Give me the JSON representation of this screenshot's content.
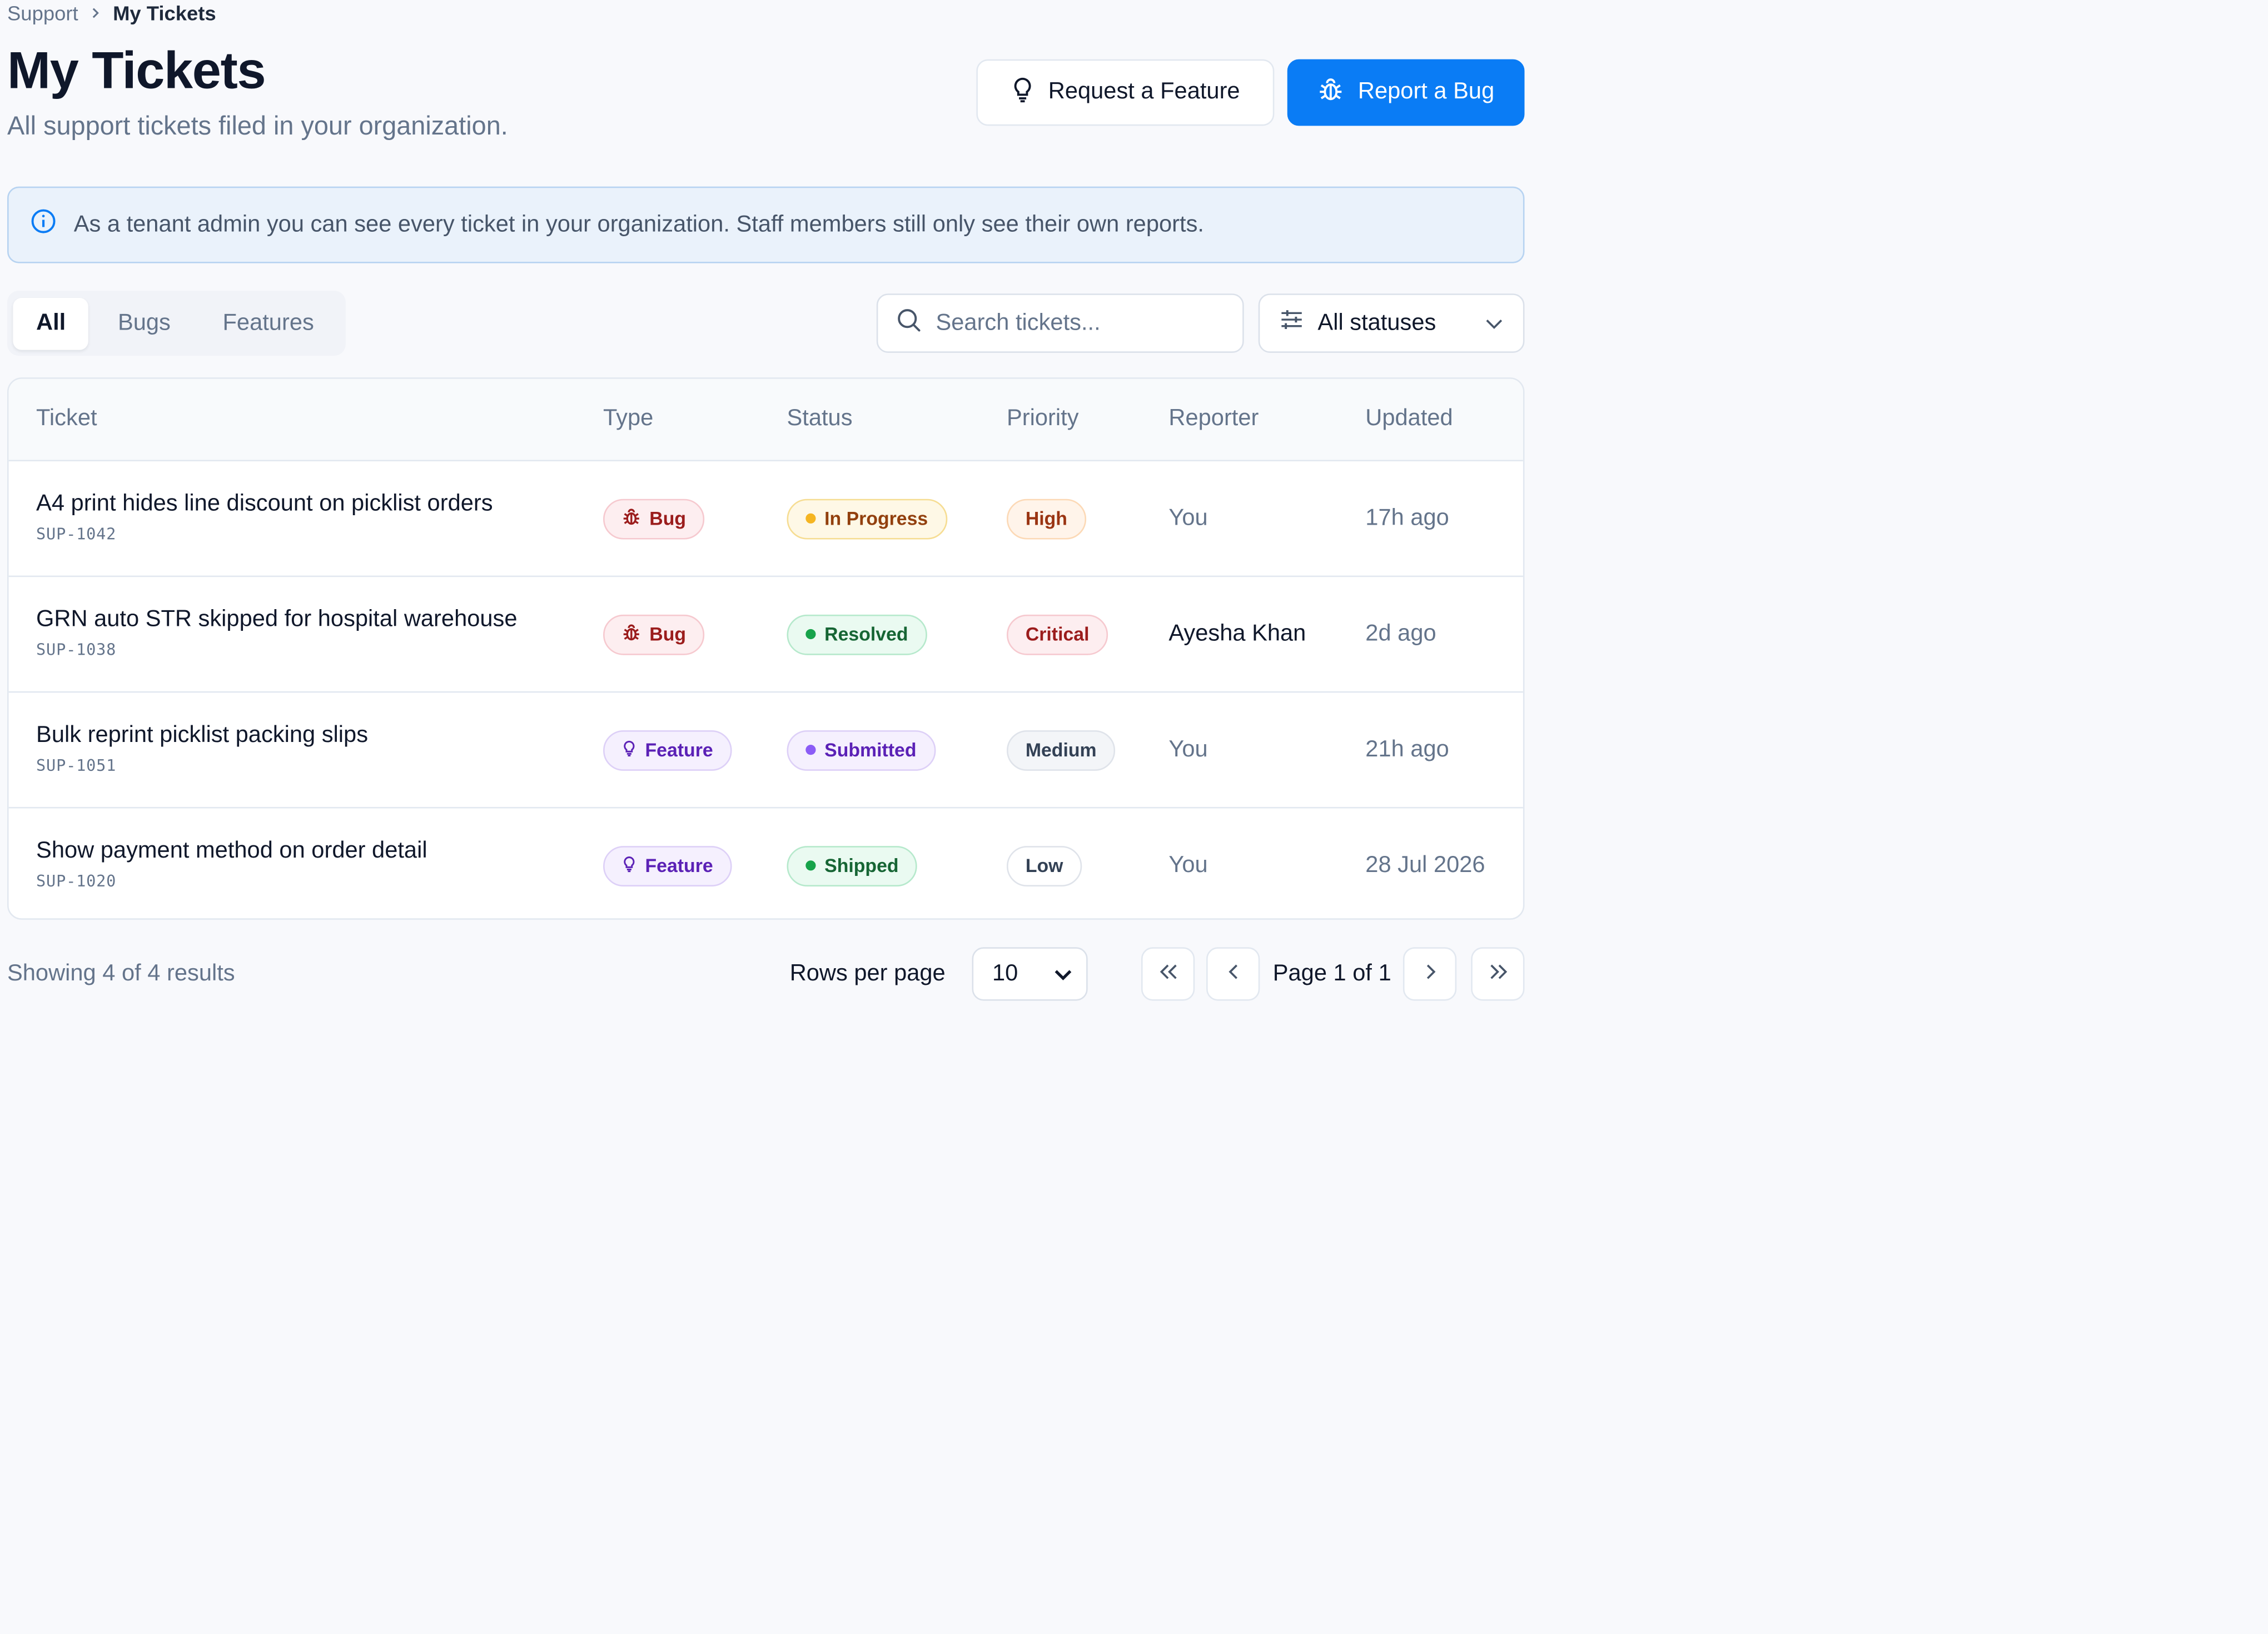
{
  "breadcrumb": {
    "parent": "Support",
    "current": "My Tickets"
  },
  "header": {
    "title": "My Tickets",
    "subtitle": "All support tickets filed in your organization.",
    "request_feature_label": "Request a Feature",
    "report_bug_label": "Report a Bug"
  },
  "banner": {
    "text": "As a tenant admin you can see every ticket in your organization. Staff members still only see their own reports."
  },
  "tabs": [
    {
      "label": "All",
      "active": true
    },
    {
      "label": "Bugs",
      "active": false
    },
    {
      "label": "Features",
      "active": false
    }
  ],
  "search": {
    "placeholder": "Search tickets...",
    "value": ""
  },
  "status_filter": {
    "selected": "All statuses"
  },
  "table": {
    "columns": [
      "Ticket",
      "Type",
      "Status",
      "Priority",
      "Reporter",
      "Updated"
    ],
    "rows": [
      {
        "title": "A4 print hides line discount on picklist orders",
        "id": "SUP-1042",
        "type": "Bug",
        "status": "In Progress",
        "priority": "High",
        "reporter": "You",
        "updated": "17h ago"
      },
      {
        "title": "GRN auto STR skipped for hospital warehouse",
        "id": "SUP-1038",
        "type": "Bug",
        "status": "Resolved",
        "priority": "Critical",
        "reporter": "Ayesha Khan",
        "updated": "2d ago"
      },
      {
        "title": "Bulk reprint picklist packing slips",
        "id": "SUP-1051",
        "type": "Feature",
        "status": "Submitted",
        "priority": "Medium",
        "reporter": "You",
        "updated": "21h ago"
      },
      {
        "title": "Show payment method on order detail",
        "id": "SUP-1020",
        "type": "Feature",
        "status": "Shipped",
        "priority": "Low",
        "reporter": "You",
        "updated": "28 Jul 2026"
      }
    ]
  },
  "footer": {
    "showing": "Showing 4 of 4 results",
    "rows_per_page_label": "Rows per page",
    "rows_per_page_value": "10",
    "page_indicator": "Page 1 of 1"
  },
  "colors": {
    "primary": "#0a7cf5",
    "background": "#f8f9fc",
    "banner_bg": "#eaf2fb"
  }
}
